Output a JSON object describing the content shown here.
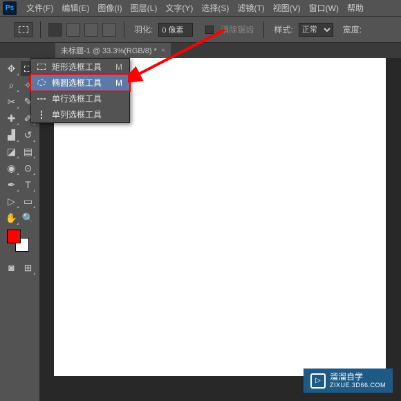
{
  "menubar": {
    "items": [
      "文件(F)",
      "编辑(E)",
      "图像(I)",
      "图层(L)",
      "文字(Y)",
      "选择(S)",
      "滤镜(T)",
      "视图(V)",
      "窗口(W)",
      "帮助"
    ]
  },
  "optionsbar": {
    "feather_label": "羽化:",
    "feather_value": "0 像素",
    "antialias_label": "消除锯齿",
    "style_label": "样式:",
    "style_value": "正常",
    "width_label": "宽度:"
  },
  "tab": {
    "title": "未标题-1 @ 33.3%(RGB/8) *"
  },
  "flyout": {
    "items": [
      {
        "label": "矩形选框工具",
        "key": "M",
        "icon": "rect"
      },
      {
        "label": "椭圆选框工具",
        "key": "M",
        "icon": "ellipse"
      },
      {
        "label": "单行选框工具",
        "key": "",
        "icon": "row"
      },
      {
        "label": "单列选框工具",
        "key": "",
        "icon": "col"
      }
    ],
    "highlight_index": 1
  },
  "colors": {
    "foreground": "#ff0000",
    "background": "#ffffff",
    "accent": "#ff0000"
  },
  "watermark": {
    "title": "溜溜自学",
    "sub": "ZIXUE.3D66.COM"
  }
}
